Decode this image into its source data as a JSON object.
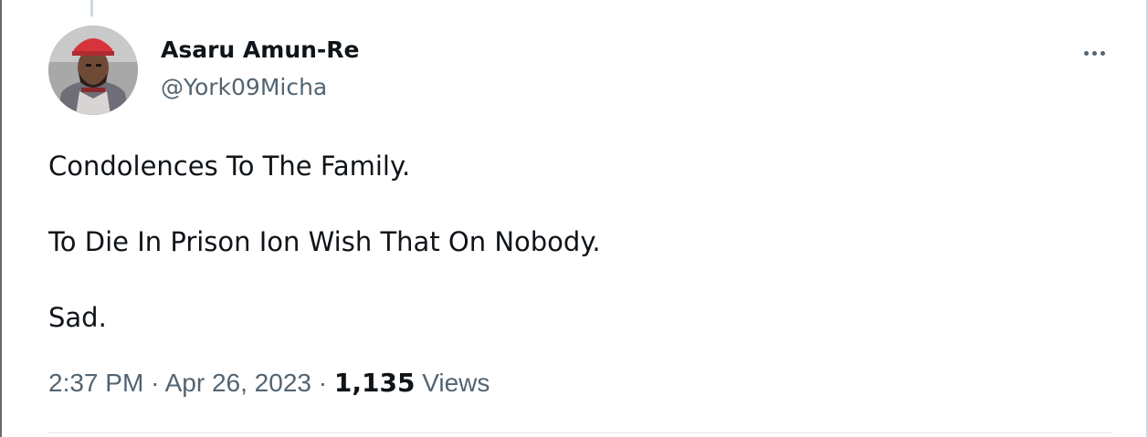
{
  "tweet": {
    "author": {
      "display_name": "Asaru Amun-Re",
      "handle": "@York09Micha",
      "avatar_icon": "user-avatar-photo"
    },
    "more_icon": "more-horizontal-icon",
    "text_lines": [
      "Condolences To The Family.",
      "To Die In Prison Ion Wish That On Nobody.",
      "Sad."
    ],
    "meta": {
      "time": "2:37 PM",
      "separator": "·",
      "date": "Apr 26, 2023",
      "views_count": "1,135",
      "views_label": "Views"
    }
  },
  "colors": {
    "primary_text": "#0f1419",
    "secondary_text": "#536471",
    "divider": "#dfe6ea",
    "thread_line": "#cfd9de"
  }
}
